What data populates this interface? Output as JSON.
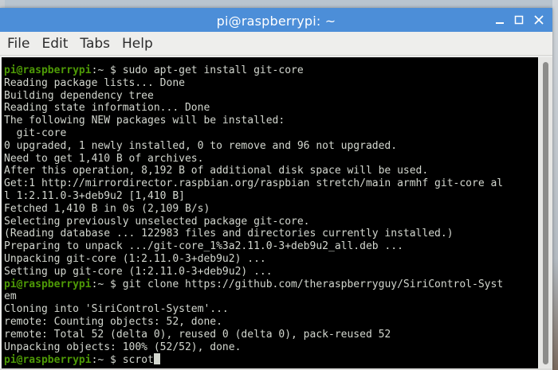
{
  "window": {
    "title": "pi@raspberrypi: ~"
  },
  "menu": {
    "file": "File",
    "edit": "Edit",
    "tabs": "Tabs",
    "help": "Help"
  },
  "terminal": {
    "prompt": "pi@raspberrypi",
    "lines": [
      {
        "prompt": true,
        "text": "sudo apt-get install git-core"
      },
      {
        "text": "Reading package lists... Done"
      },
      {
        "text": "Building dependency tree"
      },
      {
        "text": "Reading state information... Done"
      },
      {
        "text": "The following NEW packages will be installed:"
      },
      {
        "text": "  git-core"
      },
      {
        "text": "0 upgraded, 1 newly installed, 0 to remove and 96 not upgraded."
      },
      {
        "text": "Need to get 1,410 B of archives."
      },
      {
        "text": "After this operation, 8,192 B of additional disk space will be used."
      },
      {
        "text": "Get:1 http://mirrordirector.raspbian.org/raspbian stretch/main armhf git-core al"
      },
      {
        "text": "l 1:2.11.0-3+deb9u2 [1,410 B]"
      },
      {
        "text": "Fetched 1,410 B in 0s (2,109 B/s)"
      },
      {
        "text": "Selecting previously unselected package git-core."
      },
      {
        "text": "(Reading database ... 122983 files and directories currently installed.)"
      },
      {
        "text": "Preparing to unpack .../git-core_1%3a2.11.0-3+deb9u2_all.deb ..."
      },
      {
        "text": "Unpacking git-core (1:2.11.0-3+deb9u2) ..."
      },
      {
        "text": "Setting up git-core (1:2.11.0-3+deb9u2) ..."
      },
      {
        "prompt": true,
        "text": "git clone https://github.com/theraspberryguy/SiriControl-Syst"
      },
      {
        "text": "em"
      },
      {
        "text": "Cloning into 'SiriControl-System'..."
      },
      {
        "text": "remote: Counting objects: 52, done."
      },
      {
        "text": "remote: Total 52 (delta 0), reused 0 (delta 0), pack-reused 52"
      },
      {
        "text": "Unpacking objects: 100% (52/52), done."
      },
      {
        "prompt": true,
        "text": "scrot",
        "cursor": true
      }
    ]
  },
  "colors": {
    "titlebar": "#4c8ed8",
    "prompt": "#4e9a06",
    "terminal_bg": "#000000",
    "terminal_fg": "#d3d7cf"
  },
  "icons": {
    "minimize": "minimize-icon",
    "maximize": "maximize-icon",
    "close": "close-icon"
  }
}
